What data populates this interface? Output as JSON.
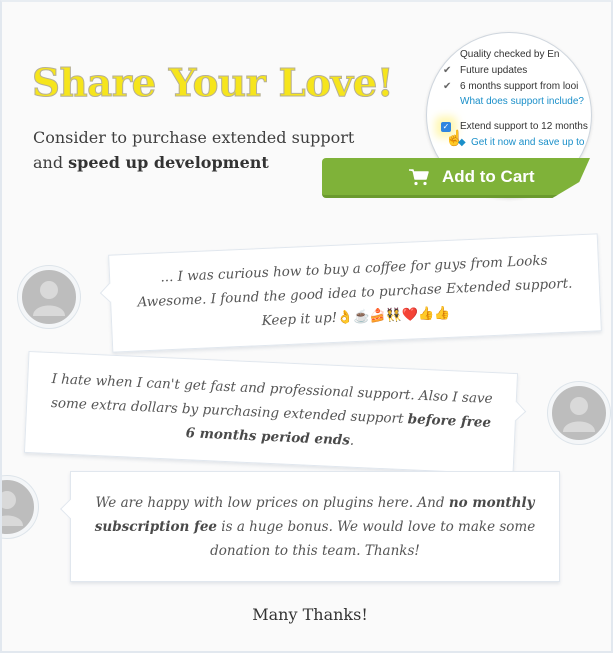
{
  "header": {
    "headline": "Share Your Love!",
    "subtitle_line1": "Consider to purchase extended support",
    "subtitle_line2_prefix": "and ",
    "subtitle_line2_bold": "speed up development"
  },
  "magnifier": {
    "lines": [
      "Quality checked by En",
      "Future updates",
      "6 months support from looi",
      "What does support include?",
      "Extend support to 12 months",
      "Get it now and save up to"
    ],
    "extend_checked": true
  },
  "cart_button": {
    "label": "Add to Cart",
    "icon": "cart-icon",
    "color": "#7fb239"
  },
  "testimonials": [
    {
      "text_before": "... I was curious how to buy a coffee for guys from Looks Awesome. I found the good idea to purchase Extended support. Keep it up!",
      "emojis": "👌☕🍰👯❤️👍👍",
      "avatar_side": "left"
    },
    {
      "text_before": "I hate when I can't get fast and professional support. Also I save some extra dollars by purchasing extended support ",
      "bold": "before free 6 months period ends",
      "text_after": ".",
      "avatar_side": "right"
    },
    {
      "text_before": "We are happy with low prices on plugins here. And ",
      "bold": "no monthly subscription fee",
      "text_after": " is a huge bonus. We would love to make some donation to this team. Thanks!",
      "avatar_side": "left"
    }
  ],
  "footer": {
    "thanks": "Many Thanks!"
  }
}
